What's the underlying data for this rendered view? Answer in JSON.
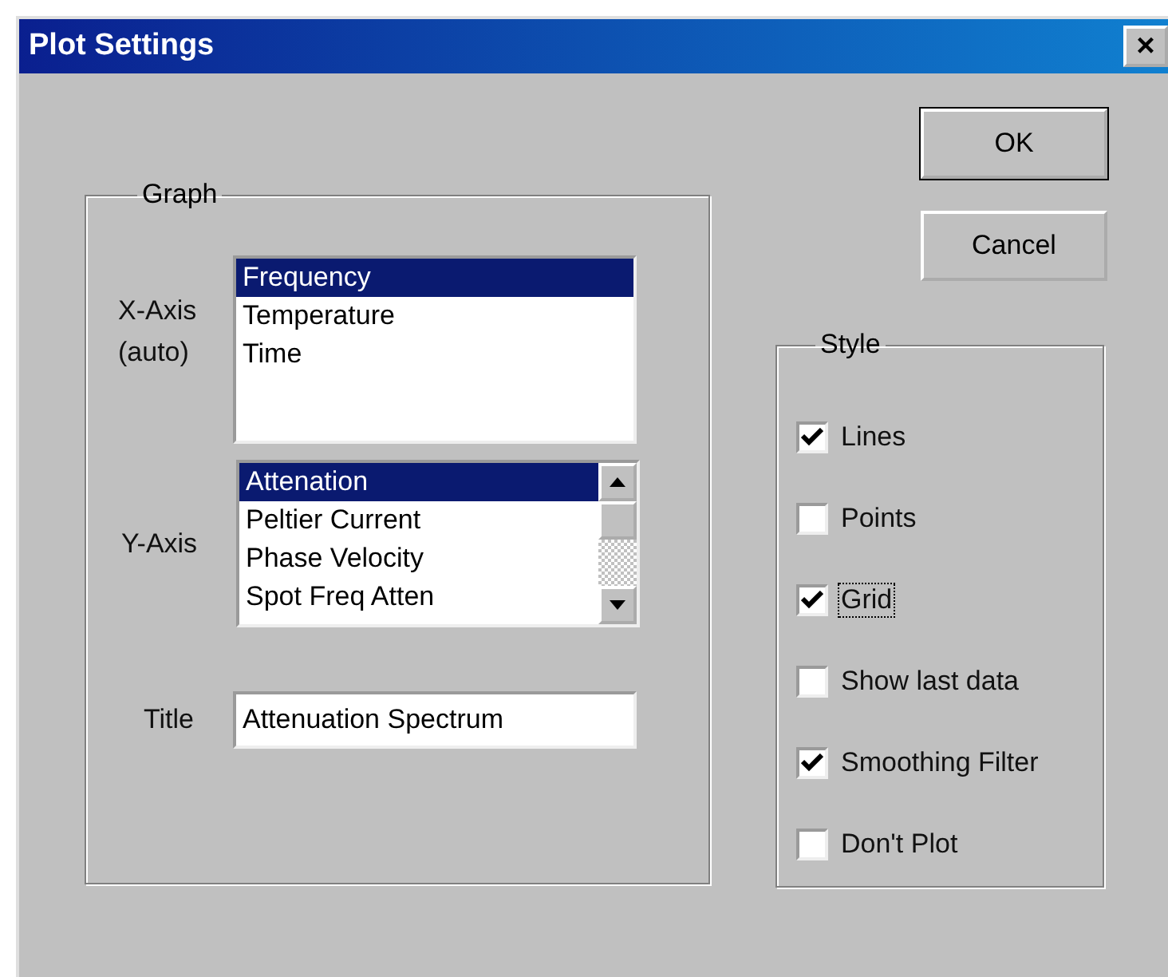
{
  "window": {
    "title": "Plot Settings",
    "close": "×"
  },
  "buttons": [
    {
      "label": "OK",
      "default": true
    },
    {
      "label": "Cancel",
      "default": false
    }
  ],
  "graph": {
    "legend": "Graph",
    "x_axis": {
      "label": "X-Axis",
      "sublabel": "(auto)",
      "items": [
        {
          "label": "Frequency",
          "selected": true
        },
        {
          "label": "Temperature",
          "selected": false
        },
        {
          "label": "Time",
          "selected": false
        }
      ]
    },
    "y_axis": {
      "label": "Y-Axis",
      "items": [
        {
          "label": "Attenation",
          "selected": true
        },
        {
          "label": "Peltier Current",
          "selected": false
        },
        {
          "label": "Phase Velocity",
          "selected": false
        },
        {
          "label": "Spot Freq Atten",
          "selected": false
        }
      ]
    },
    "title": {
      "label": "Title",
      "value": "Attenuation Spectrum"
    }
  },
  "style": {
    "legend": "Style",
    "options": [
      {
        "label": "Lines",
        "checked": true,
        "focused": false
      },
      {
        "label": "Points",
        "checked": false,
        "focused": false
      },
      {
        "label": "Grid",
        "checked": true,
        "focused": true
      },
      {
        "label": "Show last data",
        "checked": false,
        "focused": false
      },
      {
        "label": "Smoothing Filter",
        "checked": true,
        "focused": false
      },
      {
        "label": "Don't Plot",
        "checked": false,
        "focused": false
      }
    ]
  }
}
